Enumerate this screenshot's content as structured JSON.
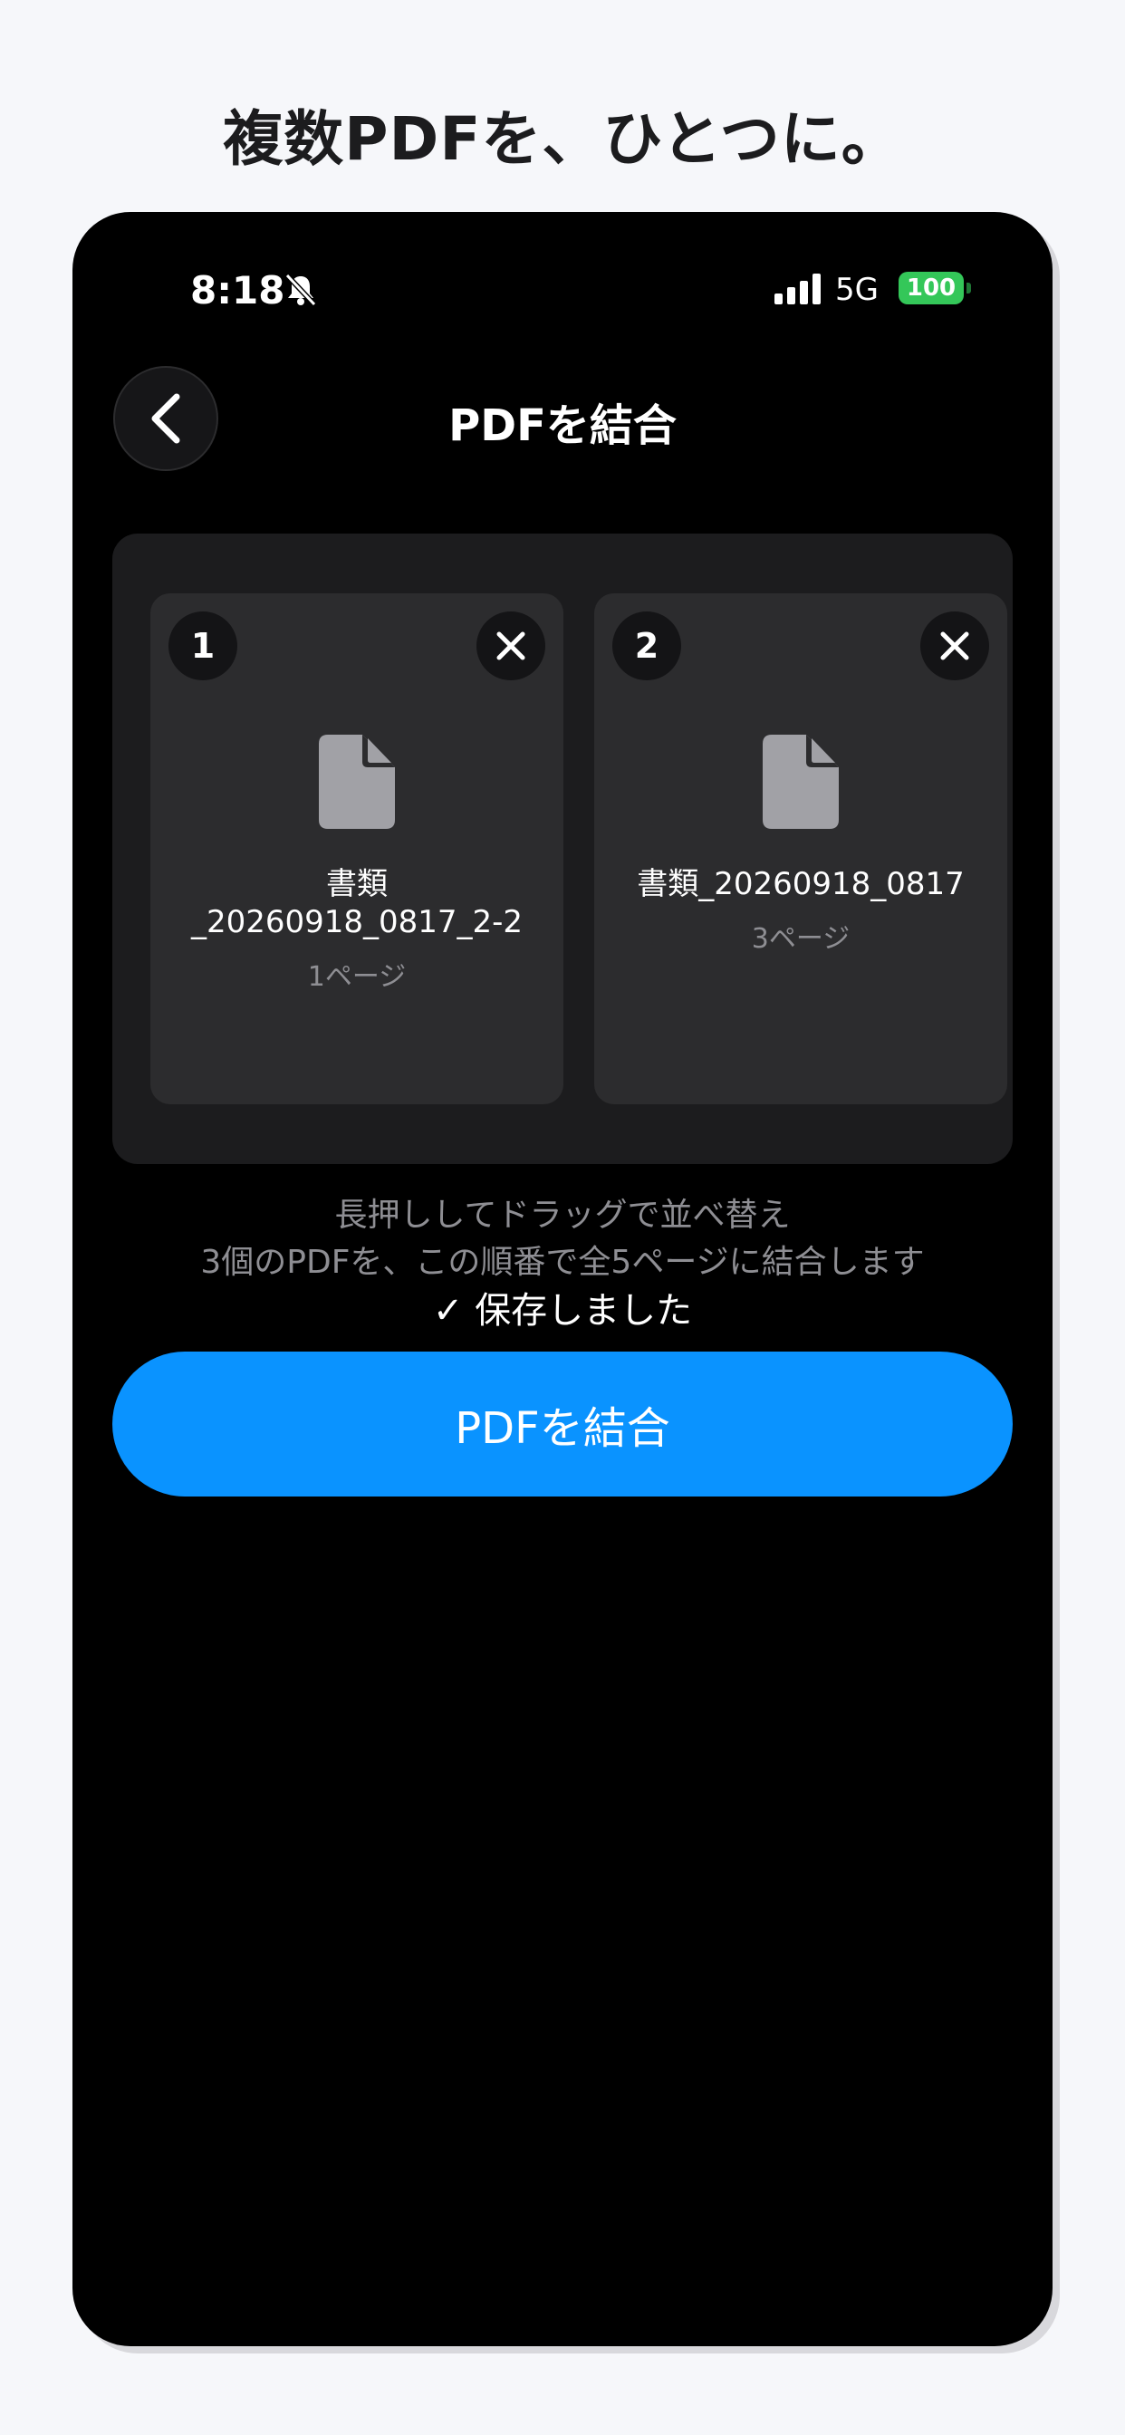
{
  "headline": "複数PDFを、ひとつに。",
  "status_bar": {
    "time": "8:18",
    "network": "5G",
    "battery": "100",
    "battery_color": "#34c759"
  },
  "nav": {
    "back_icon": "chevron-left-icon",
    "title": "PDFを結合"
  },
  "files": [
    {
      "order": "1",
      "name_line1": "書類",
      "name_line2": "_20260918_0817_2-2",
      "pages": "1ページ"
    },
    {
      "order": "2",
      "name_line1": "書類_20260918_0817",
      "name_line2": "",
      "pages": "3ページ"
    }
  ],
  "hints": {
    "reorder": "長押ししてドラッグで並べ替え",
    "summary": "3個のPDFを、この順番で全5ページに結合します"
  },
  "saved_message": "✓ 保存しました",
  "merge_button": {
    "label": "PDFを結合",
    "color": "#0a93ff"
  }
}
